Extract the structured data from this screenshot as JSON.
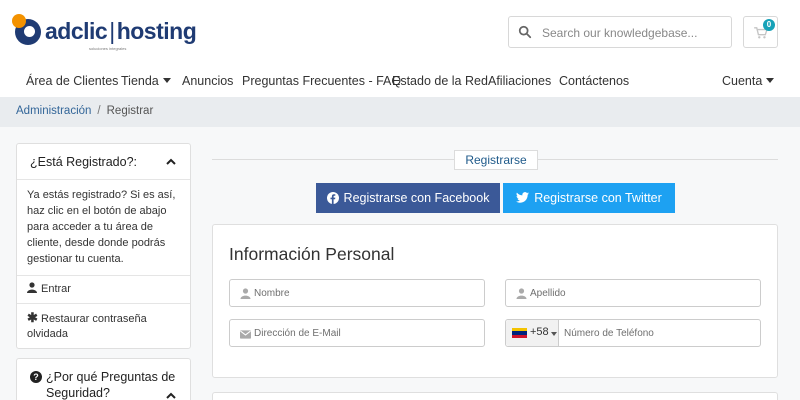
{
  "brand": {
    "logo_name": "adclic",
    "logo_sep": "|",
    "logo_suffix": "hosting",
    "tagline": "soluciones integrales",
    "colors": {
      "primary": "#1f3b73",
      "accent": "#f39200"
    }
  },
  "header": {
    "search": {
      "placeholder": "Search our knowledgebase...",
      "value": "",
      "icon": "search-icon"
    },
    "cart": {
      "icon": "cart-icon",
      "count": "0"
    }
  },
  "nav": {
    "items": [
      {
        "label": "Área de Clientes",
        "dropdown": false
      },
      {
        "label": "Tienda",
        "dropdown": true
      },
      {
        "label": "Anuncios",
        "dropdown": false
      },
      {
        "label": "Preguntas Frecuentes - FAQ",
        "dropdown": false
      },
      {
        "label": "Estado de la Red",
        "dropdown": false
      },
      {
        "label": "Afiliaciones",
        "dropdown": false
      },
      {
        "label": "Contáctenos",
        "dropdown": false
      }
    ],
    "account": {
      "label": "Cuenta",
      "dropdown": true
    }
  },
  "breadcrumb": {
    "items": [
      {
        "label": "Administración"
      },
      {
        "label": "Registrar"
      }
    ],
    "separator": "/"
  },
  "sidebar": {
    "registered": {
      "title": "¿Está Registrado?:",
      "body": "Ya estás registrado? Si es así, haz clic en el botón de abajo para acceder a tu área de cliente, desde donde podrás gestionar tu cuenta.",
      "links": [
        {
          "label": "Entrar",
          "icon": "user-icon"
        },
        {
          "label": "Restaurar contraseña olvidada",
          "icon": "asterisk-icon"
        }
      ]
    },
    "security": {
      "title": "¿Por qué Preguntas de Seguridad?",
      "icon": "question-circle-icon"
    }
  },
  "main": {
    "divider_label": "Registrarse",
    "social": {
      "facebook": {
        "label": "Registrarse con Facebook",
        "color": "#3b5998"
      },
      "twitter": {
        "label": "Registrarse con Twitter",
        "color": "#1da1f2"
      }
    },
    "personal": {
      "title": "Información Personal",
      "fields": {
        "first_name": {
          "placeholder": "Nombre",
          "value": ""
        },
        "last_name": {
          "placeholder": "Apellido",
          "value": ""
        },
        "email": {
          "placeholder": "Dirección de E-Mail",
          "value": ""
        },
        "phone": {
          "placeholder": "Número de Teléfono",
          "value": "",
          "dial_code": "+58",
          "country": "VE"
        }
      }
    }
  }
}
